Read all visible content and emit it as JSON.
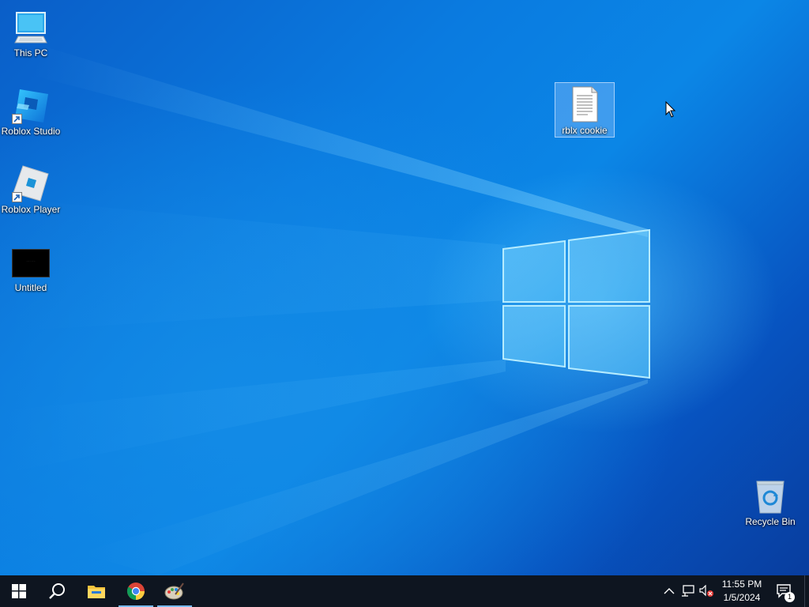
{
  "desktop": {
    "icons": [
      {
        "label": "This PC",
        "icon": "monitor-icon"
      },
      {
        "label": "Roblox Studio",
        "icon": "roblox-studio-icon"
      },
      {
        "label": "Roblox Player",
        "icon": "roblox-player-icon"
      },
      {
        "label": "Untitled",
        "icon": "black-image-thumbnail"
      },
      {
        "label": "rblx cookie",
        "icon": "text-document-icon",
        "selected": true
      },
      {
        "label": "Recycle Bin",
        "icon": "recycle-bin-icon"
      }
    ],
    "untitled_thumbnail_text": "· · · · ·"
  },
  "taskbar": {
    "pinned": [
      {
        "name": "start",
        "icon": "windows-logo-icon"
      },
      {
        "name": "search",
        "icon": "search-icon"
      },
      {
        "name": "file-explorer",
        "icon": "folder-icon"
      },
      {
        "name": "chrome",
        "icon": "chrome-icon",
        "active": true
      },
      {
        "name": "paint",
        "icon": "paint-palette-icon",
        "active": true
      }
    ],
    "tray": {
      "chevron": "chevron-up-icon",
      "network": "network-icon",
      "volume": "volume-muted-icon"
    },
    "clock": {
      "time": "11:55 PM",
      "date": "1/5/2024"
    },
    "notifications": {
      "count": "1",
      "icon": "action-center-icon"
    }
  },
  "colors": {
    "taskbar_bg": "#0e1520",
    "accent": "#76b9ed",
    "selection": "#a0c8ff"
  }
}
